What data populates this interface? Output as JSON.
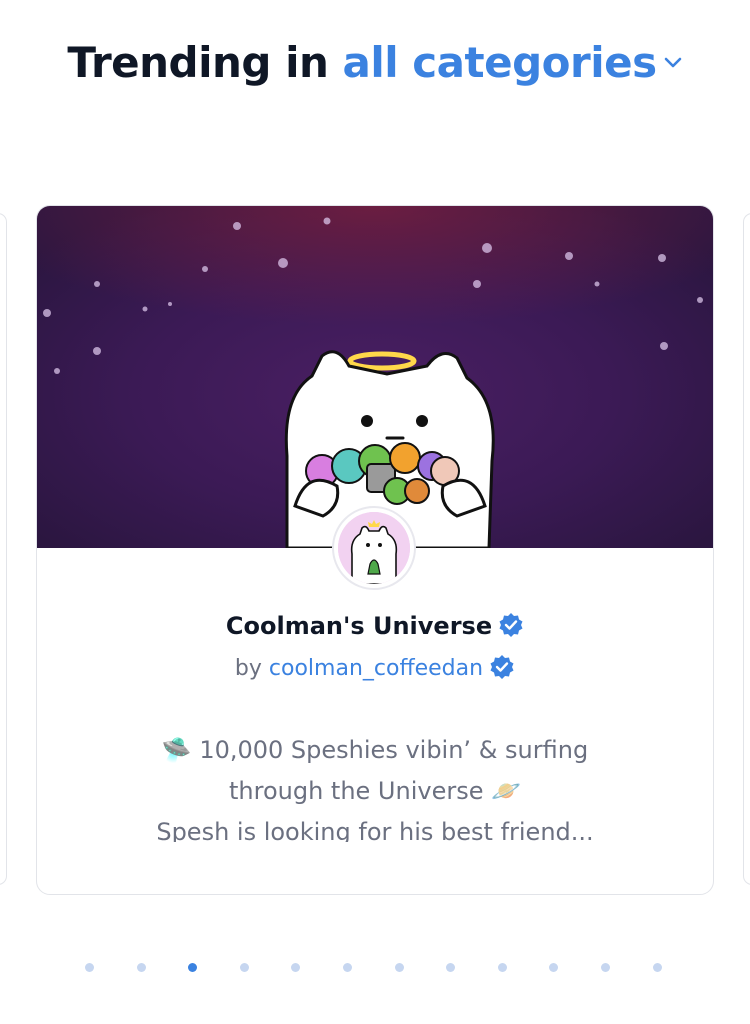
{
  "header": {
    "prefix": "Trending in",
    "category": "all categories"
  },
  "card": {
    "title": "Coolman's Universe",
    "by_label": "by",
    "creator": "coolman_coffeedan",
    "description_lines": [
      "🛸 10,000 Speshies vibin’ & surfing",
      "through the Universe 🪐",
      "Spesh is looking for his best friend..."
    ]
  },
  "pagination": {
    "total": 12,
    "active_index": 2
  },
  "colors": {
    "accent": "#3b82e0",
    "heading": "#0f1726",
    "muted": "#6b7080",
    "dot_inactive": "#c6d6f0"
  },
  "icons": {
    "dropdown": "chevron-down-icon",
    "verified": "verified-badge-icon"
  }
}
